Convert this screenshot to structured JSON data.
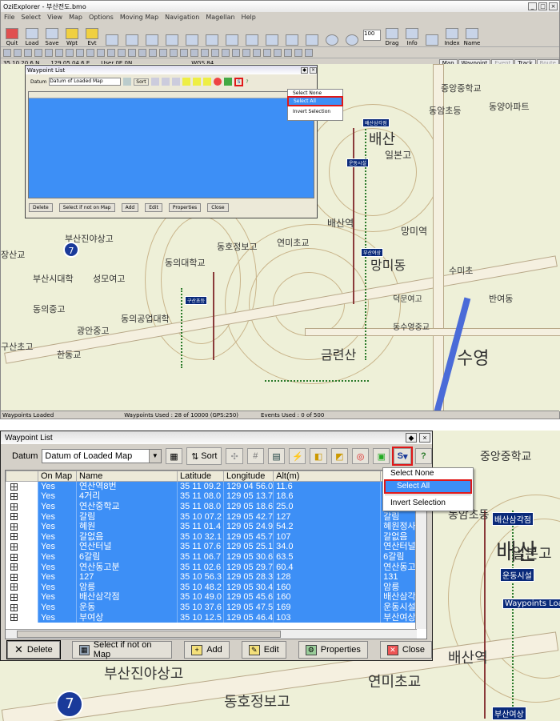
{
  "app": {
    "title": "OziExplorer - 부산전도.bmo",
    "menu": [
      "File",
      "Select",
      "View",
      "Map",
      "Options",
      "Moving Map",
      "Navigation",
      "Magellan",
      "Help"
    ],
    "toolbar": [
      {
        "label": "Quit"
      },
      {
        "label": "Load"
      },
      {
        "label": "Save"
      },
      {
        "label": "Wpt"
      },
      {
        "label": "Evt"
      },
      {
        "label": "Drag"
      },
      {
        "label": "Info"
      },
      {
        "label": "Index"
      },
      {
        "label": "Name"
      }
    ],
    "zoom_value": "100",
    "coords": {
      "lat": "35 10 20.6 N",
      "lon": "129 05 04.6 E",
      "user": "User  0E  0N",
      "datum": "WGS 84"
    },
    "view_tabs": [
      "Map",
      "Waypoint",
      "Event",
      "Track",
      "Route"
    ],
    "status": {
      "left": "Waypoints Loaded",
      "used": "Waypoints Used : 28 of 10000  (GPS:250)",
      "events": "Events Used : 0 of 500"
    }
  },
  "map_labels": [
    "중앙중학교",
    "동암초등",
    "동양아파트",
    "배산삼각점",
    "운동시설",
    "배산",
    "일본고",
    "배산역",
    "망미역",
    "망미동",
    "부산여상",
    "연미초교",
    "동의대학교",
    "동의공업대학",
    "구산초등",
    "동의중고",
    "광안중고",
    "구산초고",
    "금련산",
    "수영",
    "동수영중교",
    "덕문여고",
    "수미초",
    "반여동",
    "부산진야상고",
    "부산시대학",
    "성모여고",
    "한동교",
    "동호정보고",
    "장산교"
  ],
  "waypoint_list": {
    "title": "Waypoint List",
    "datum_label": "Datum",
    "datum_value": "Datum of Loaded Map",
    "sort_label": "Sort",
    "select_menu_label": "S",
    "help_label": "?",
    "columns": [
      "",
      "On Map",
      "Name",
      "Latitude",
      "Longitude",
      "Alt(m)",
      ""
    ],
    "rows": [
      {
        "on_map": "Yes",
        "name": "연산역8번",
        "lat": "35 11 09.2",
        "lon": "129 04 56.0",
        "alt": "11.6",
        "desc": ""
      },
      {
        "on_map": "Yes",
        "name": "4거리",
        "lat": "35 11 08.0",
        "lon": "129 05 13.7",
        "alt": "18.6",
        "desc": ""
      },
      {
        "on_map": "Yes",
        "name": "연산중학교",
        "lat": "35 11 08.0",
        "lon": "129 05 18.6",
        "alt": "25.0",
        "desc": ""
      },
      {
        "on_map": "Yes",
        "name": "갈림",
        "lat": "35 10 07.2",
        "lon": "129 05 42.7",
        "alt": "127",
        "desc": "갈림"
      },
      {
        "on_map": "Yes",
        "name": "혜원",
        "lat": "35 11 01.4",
        "lon": "129 05 24.9",
        "alt": "54.2",
        "desc": "혜원정사"
      },
      {
        "on_map": "Yes",
        "name": "갈없음",
        "lat": "35 10 32.1",
        "lon": "129 05 45.7",
        "alt": "107",
        "desc": "갈없음"
      },
      {
        "on_map": "Yes",
        "name": "연산터널",
        "lat": "35 11 07.6",
        "lon": "129 05 25.1",
        "alt": "34.0",
        "desc": "연산터널"
      },
      {
        "on_map": "Yes",
        "name": "6갈림",
        "lat": "35 11 06.7",
        "lon": "129 05 30.6",
        "alt": "63.5",
        "desc": "6갈림"
      },
      {
        "on_map": "Yes",
        "name": "연산동고분",
        "lat": "35 11 02.6",
        "lon": "129 05 29.7",
        "alt": "60.4",
        "desc": "연산동고"
      },
      {
        "on_map": "Yes",
        "name": "127",
        "lat": "35 10 56.3",
        "lon": "129 05 28.3",
        "alt": "128",
        "desc": "131"
      },
      {
        "on_map": "Yes",
        "name": "암릉",
        "lat": "35 10 48.2",
        "lon": "129 05 30.4",
        "alt": "160",
        "desc": "암릉"
      },
      {
        "on_map": "Yes",
        "name": "배산삼각점",
        "lat": "35 10 49.0",
        "lon": "129 05 45.6",
        "alt": "160",
        "desc": "배산삼각"
      },
      {
        "on_map": "Yes",
        "name": "운동",
        "lat": "35 10 37.6",
        "lon": "129 05 47.5",
        "alt": "169",
        "desc": "운동시설"
      },
      {
        "on_map": "Yes",
        "name": "부여상",
        "lat": "35 10 12.5",
        "lon": "129 05 46.4",
        "alt": "103",
        "desc": "부산여상"
      }
    ],
    "buttons": {
      "delete": "Delete",
      "select_not_on_map": "Select if not on Map",
      "add": "Add",
      "edit": "Edit",
      "properties": "Properties",
      "close": "Close"
    }
  },
  "select_popup": {
    "items": [
      "Select None",
      "Select All",
      "Invert Selection"
    ],
    "highlighted": "Select All"
  },
  "colors": {
    "selection": "#3d8ff6",
    "highlight_box": "#e01818",
    "waypoint_marker": "#0a2a7a"
  }
}
